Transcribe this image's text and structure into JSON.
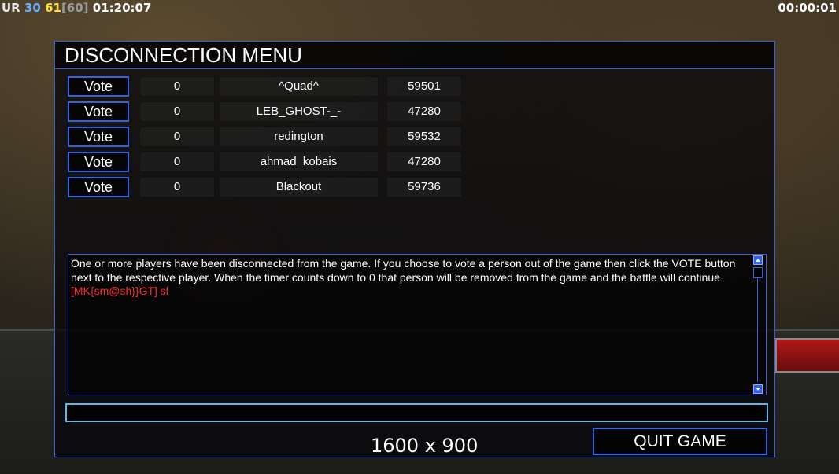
{
  "hud": {
    "stats_prefix": "UR",
    "fps": "30",
    "fps_cap": "61",
    "fps_max": "[60]",
    "game_time": "01:20:07",
    "timer": "00:00:01"
  },
  "dialog": {
    "title": "DISCONNECTION MENU",
    "players": [
      {
        "vote_label": "Vote",
        "votes": "0",
        "name": "^Quad^",
        "ping": "59501"
      },
      {
        "vote_label": "Vote",
        "votes": "0",
        "name": "LEB_GHOST-_-",
        "ping": "47280"
      },
      {
        "vote_label": "Vote",
        "votes": "0",
        "name": "redington",
        "ping": "59532"
      },
      {
        "vote_label": "Vote",
        "votes": "0",
        "name": "ahmad_kobais",
        "ping": "47280"
      },
      {
        "vote_label": "Vote",
        "votes": "0",
        "name": "Blackout",
        "ping": "59736"
      }
    ],
    "chat": {
      "message": "One or more players have been disconnected from the game. If you choose to vote a person out of the game then click the VOTE button next to the respective player. When the timer counts down to 0 that person will be removed from the game and the battle will continue",
      "player_message": "[MK{sm@sh}}GT] sl"
    },
    "chat_input_value": "",
    "resolution": "1600 x 900",
    "quit_label": "QUIT GAME"
  },
  "colors": {
    "accent_blue": "#2e63e6",
    "chat_red": "#ff2a2a",
    "fps_blue": "#6bb0ff",
    "fps_yellow": "#ffe033"
  }
}
